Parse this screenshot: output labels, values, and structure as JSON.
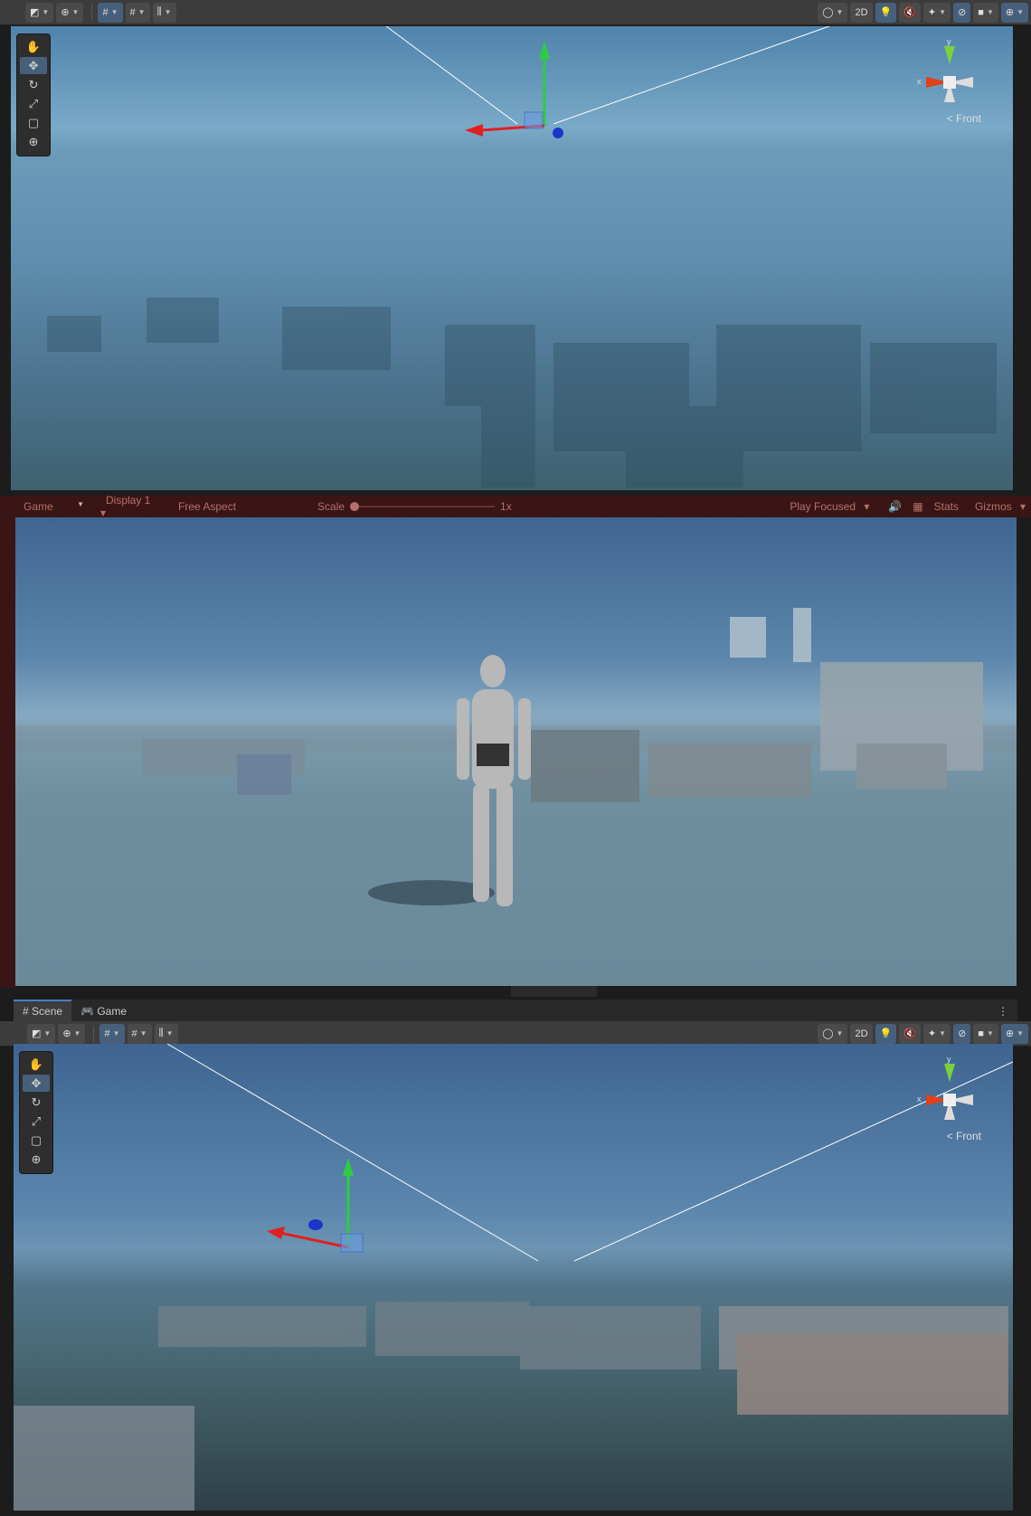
{
  "scene_toolbar": {
    "btn_2d": "2D"
  },
  "scene_view": {
    "front_label": "Front",
    "axis_x": "x",
    "axis_y": "y"
  },
  "game_toolbar": {
    "tab": "Game",
    "display": "Display 1",
    "aspect": "Free Aspect",
    "scale_label": "Scale",
    "scale_value": "1x",
    "scale_fraction": 0,
    "play_mode": "Play Focused",
    "stats": "Stats",
    "gizmos": "Gizmos"
  },
  "bottom_tabs": {
    "scene": "Scene",
    "game": "Game"
  },
  "colors": {
    "play_tint": "#3a1515",
    "accent": "#46607c"
  }
}
